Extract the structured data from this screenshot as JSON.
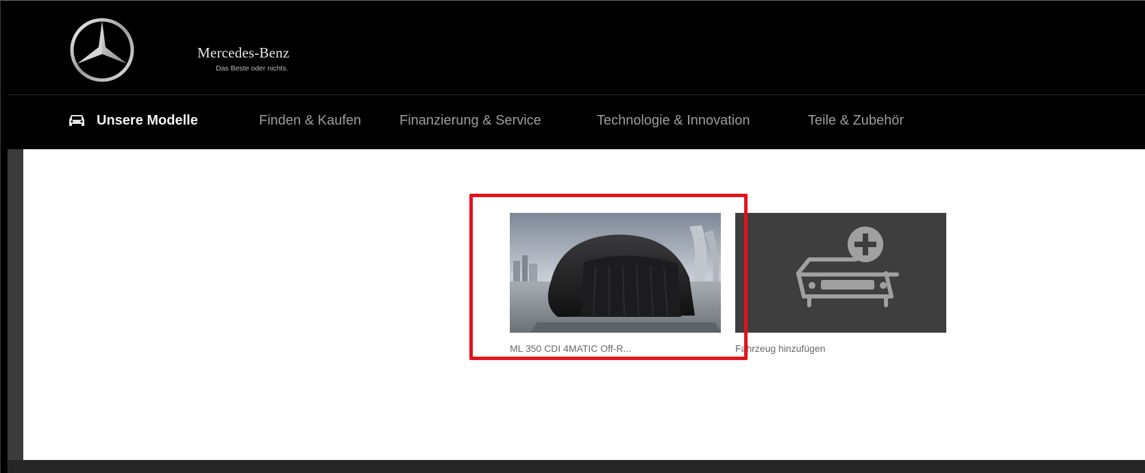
{
  "header": {
    "brand": "Mercedes-Benz",
    "tagline": "Das Beste oder nichts.",
    "logo_icon": "mercedes-star-icon"
  },
  "nav": {
    "car_icon": "car-icon",
    "items": [
      {
        "label": "Unsere Modelle"
      },
      {
        "label": "Finden & Kaufen"
      },
      {
        "label": "Finanzierung & Service"
      },
      {
        "label": "Technologie & Innovation"
      },
      {
        "label": "Teile & Zubehör"
      }
    ]
  },
  "vehicles": {
    "selected_caption": "ML 350 CDI 4MATIC Off-R...",
    "add_caption": "Fahrzeug hinzufügen",
    "add_icon": "add-vehicle-icon"
  },
  "colors": {
    "background": "#000000",
    "content": "#ffffff",
    "add_tile": "#3e3e3e",
    "highlight": "#e3121b"
  }
}
